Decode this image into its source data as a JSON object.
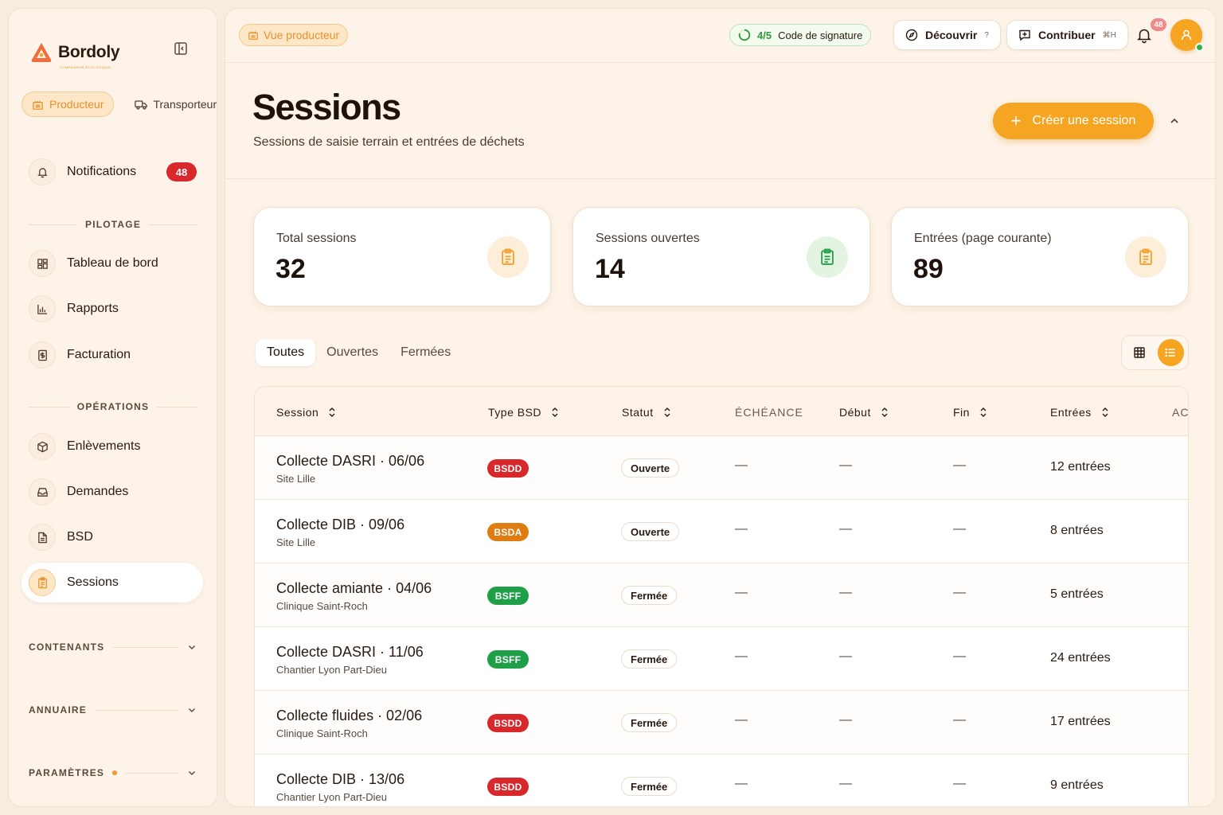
{
  "sidebar": {
    "brand": "Bordoly",
    "brand_tagline": "COMPAGNON ÉCOLOGIQUE",
    "roles": [
      {
        "label": "Producteur",
        "active": true
      },
      {
        "label": "Transporteur",
        "active": false
      }
    ],
    "notifications": {
      "label": "Notifications",
      "count": "48"
    },
    "sections": {
      "pilotage": "PILOTAGE",
      "operations": "OPÉRATIONS",
      "contenants": "CONTENANTS",
      "annuaire": "ANNUAIRE",
      "parametres": "PARAMÈTRES"
    },
    "pilotage_items": [
      {
        "label": "Tableau de bord",
        "icon": "dashboard-icon"
      },
      {
        "label": "Rapports",
        "icon": "bar-chart-icon"
      },
      {
        "label": "Facturation",
        "icon": "invoice-icon"
      }
    ],
    "operations_items": [
      {
        "label": "Enlèvements",
        "icon": "package-icon"
      },
      {
        "label": "Demandes",
        "icon": "inbox-icon"
      },
      {
        "label": "BSD",
        "icon": "document-icon"
      },
      {
        "label": "Sessions",
        "icon": "clipboard-icon",
        "active": true
      }
    ]
  },
  "topbar": {
    "view_label": "Vue producteur",
    "signature": {
      "fraction": "4/5",
      "label": "Code de signature"
    },
    "discover": {
      "label": "Découvrir",
      "hint": "?"
    },
    "contribute": {
      "label": "Contribuer",
      "shortcut": "⌘H"
    },
    "bell_count": "48"
  },
  "header": {
    "title": "Sessions",
    "subtitle": "Sessions de saisie terrain et entrées de déchets",
    "create_label": "Créer une session"
  },
  "stats": [
    {
      "label": "Total sessions",
      "value": "32",
      "tone": "orange"
    },
    {
      "label": "Sessions ouvertes",
      "value": "14",
      "tone": "green"
    },
    {
      "label": "Entrées (page courante)",
      "value": "89",
      "tone": "orange"
    }
  ],
  "tabs": [
    "Toutes",
    "Ouvertes",
    "Fermées"
  ],
  "table": {
    "columns": [
      "Session",
      "Type BSD",
      "Statut",
      "ÉCHÉANCE",
      "Début",
      "Fin",
      "Entrées",
      "AC"
    ],
    "rows": [
      {
        "title": "Collecte DASRI · 06/06",
        "site": "Site Lille",
        "bsd": "BSDD",
        "bsd_color": "#d8282c",
        "status": "Ouverte",
        "echeance": "—",
        "debut": "—",
        "fin": "—",
        "entries": "12 entrées"
      },
      {
        "title": "Collecte DIB · 09/06",
        "site": "Site Lille",
        "bsd": "BSDA",
        "bsd_color": "#e07d12",
        "status": "Ouverte",
        "echeance": "—",
        "debut": "—",
        "fin": "—",
        "entries": "8 entrées"
      },
      {
        "title": "Collecte amiante · 04/06",
        "site": "Clinique Saint-Roch",
        "bsd": "BSFF",
        "bsd_color": "#1fa047",
        "status": "Fermée",
        "echeance": "—",
        "debut": "—",
        "fin": "—",
        "entries": "5 entrées"
      },
      {
        "title": "Collecte DASRI · 11/06",
        "site": "Chantier Lyon Part-Dieu",
        "bsd": "BSFF",
        "bsd_color": "#1fa047",
        "status": "Fermée",
        "echeance": "—",
        "debut": "—",
        "fin": "—",
        "entries": "24 entrées"
      },
      {
        "title": "Collecte fluides · 02/06",
        "site": "Clinique Saint-Roch",
        "bsd": "BSDD",
        "bsd_color": "#d8282c",
        "status": "Fermée",
        "echeance": "—",
        "debut": "—",
        "fin": "—",
        "entries": "17 entrées"
      },
      {
        "title": "Collecte DIB · 13/06",
        "site": "Chantier Lyon Part-Dieu",
        "bsd": "BSDD",
        "bsd_color": "#d8282c",
        "status": "Fermée",
        "echeance": "—",
        "debut": "—",
        "fin": "—",
        "entries": "9 entrées"
      }
    ]
  },
  "colors": {
    "accent": "#f6a523",
    "green": "#1fa047",
    "red": "#d8282c"
  }
}
